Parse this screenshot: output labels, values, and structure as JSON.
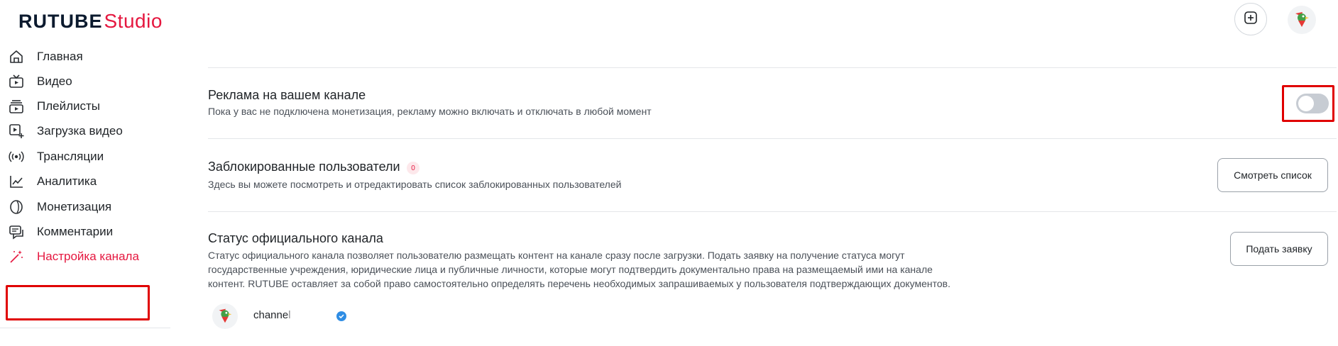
{
  "header": {
    "logo_primary": "RUTUBE",
    "logo_secondary": "Studio",
    "add_button_icon": "plus-square-icon",
    "avatar_icon": "bird-avatar-icon"
  },
  "sidebar": {
    "items": [
      {
        "label": "Главная",
        "icon": "home-icon"
      },
      {
        "label": "Видео",
        "icon": "tv-icon"
      },
      {
        "label": "Плейлисты",
        "icon": "playlist-icon"
      },
      {
        "label": "Загрузка видео",
        "icon": "upload-video-icon"
      },
      {
        "label": "Трансляции",
        "icon": "broadcast-icon"
      },
      {
        "label": "Аналитика",
        "icon": "chart-line-icon"
      },
      {
        "label": "Монетизация",
        "icon": "coin-icon"
      },
      {
        "label": "Комментарии",
        "icon": "comments-icon"
      },
      {
        "label": "Настройка канала",
        "icon": "magic-wand-icon",
        "active": true
      }
    ]
  },
  "settings": {
    "ads": {
      "title": "Реклама на вашем канале",
      "description": "Пока у вас не подключена монетизация, рекламу можно включать и отключать в любой момент",
      "enabled": false
    },
    "blocked": {
      "title": "Заблокированные пользователи",
      "count": "0",
      "description": "Здесь вы можете посмотреть и отредактировать список заблокированных пользователей",
      "button": "Смотреть список"
    },
    "official": {
      "title": "Статус официального канала",
      "description_lines": [
        "Статус официального канала позволяет пользователю размещать контент на канале сразу после загрузки. Подать заявку на получение статуса могут",
        "государственные учреждения, юридические лица и публичные личности, которые могут подтвердить документально права на размещаемый ими на канале",
        "контент. RUTUBE оставляет за собой право самостоятельно определять перечень необходимых запрашиваемых у пользователя подтверждающих документов."
      ],
      "button": "Подать заявку"
    }
  },
  "channel": {
    "name": "channel",
    "verified_icon": "verified-check-icon"
  },
  "colors": {
    "accent": "#e5173f",
    "highlight": "#e00000",
    "toggle_off": "#c7ccd3",
    "verified": "#2f8de4"
  }
}
